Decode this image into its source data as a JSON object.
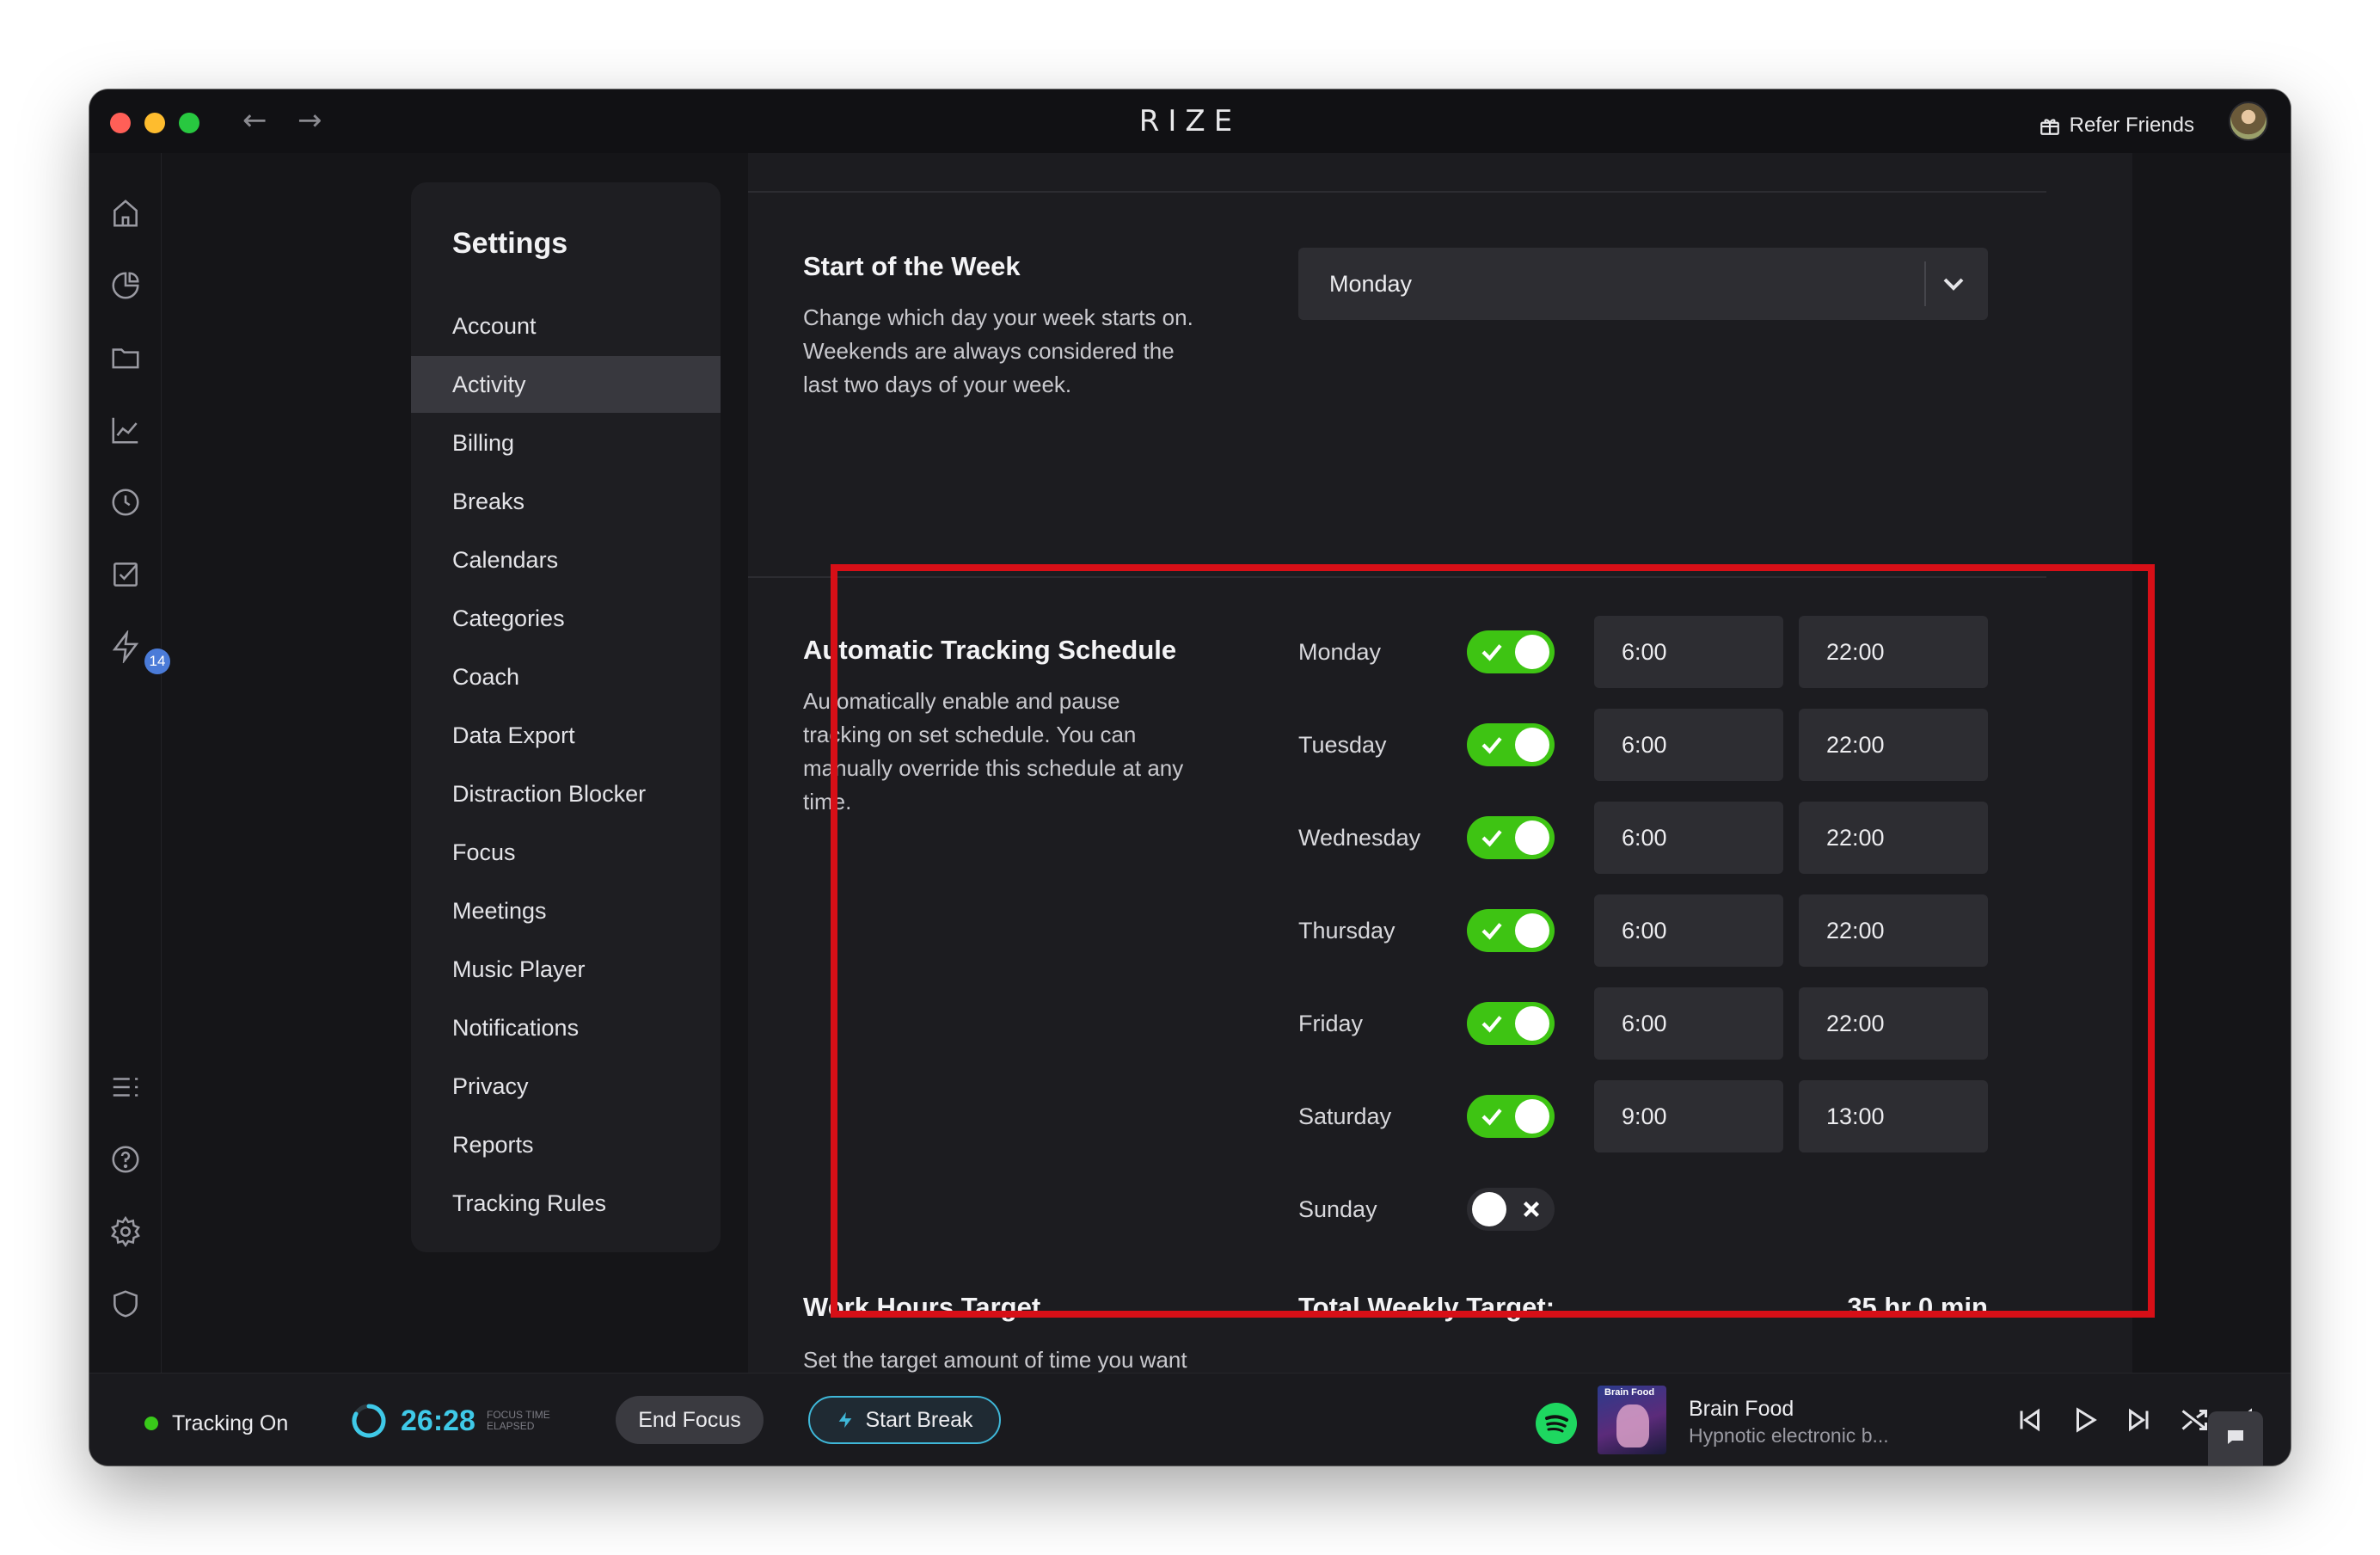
{
  "window": {
    "app_title": "RIZE",
    "refer_label": "Refer Friends"
  },
  "rail": {
    "notification_count": "14"
  },
  "settings_nav": {
    "title": "Settings",
    "items": [
      {
        "label": "Account"
      },
      {
        "label": "Activity",
        "active": true
      },
      {
        "label": "Billing"
      },
      {
        "label": "Breaks"
      },
      {
        "label": "Calendars"
      },
      {
        "label": "Categories"
      },
      {
        "label": "Coach"
      },
      {
        "label": "Data Export"
      },
      {
        "label": "Distraction Blocker"
      },
      {
        "label": "Focus"
      },
      {
        "label": "Meetings"
      },
      {
        "label": "Music Player"
      },
      {
        "label": "Notifications"
      },
      {
        "label": "Privacy"
      },
      {
        "label": "Reports"
      },
      {
        "label": "Tracking Rules"
      }
    ]
  },
  "week_start": {
    "title": "Start of the Week",
    "description_lines": [
      "Change which day your week starts on.",
      "Weekends are always considered the",
      "last two days of your week."
    ],
    "selected": "Monday"
  },
  "schedule": {
    "title": "Automatic Tracking Schedule",
    "description_lines": [
      "Automatically enable and pause",
      "tracking on set schedule. You can",
      "manually override this schedule at any",
      "time."
    ],
    "days": [
      {
        "day": "Monday",
        "enabled": true,
        "start": "6:00",
        "end": "22:00"
      },
      {
        "day": "Tuesday",
        "enabled": true,
        "start": "6:00",
        "end": "22:00"
      },
      {
        "day": "Wednesday",
        "enabled": true,
        "start": "6:00",
        "end": "22:00"
      },
      {
        "day": "Thursday",
        "enabled": true,
        "start": "6:00",
        "end": "22:00"
      },
      {
        "day": "Friday",
        "enabled": true,
        "start": "6:00",
        "end": "22:00"
      },
      {
        "day": "Saturday",
        "enabled": true,
        "start": "9:00",
        "end": "13:00"
      },
      {
        "day": "Sunday",
        "enabled": false,
        "start": "",
        "end": ""
      }
    ]
  },
  "work_hours": {
    "title": "Work Hours Target",
    "description": "Set the target amount of time you want",
    "weekly_label": "Total Weekly Target:",
    "weekly_value": "35 hr 0 min"
  },
  "bottom_bar": {
    "status": "Tracking On",
    "timer": "26:28",
    "timer_caption_1": "FOCUS TIME",
    "timer_caption_2": "ELAPSED",
    "end_focus": "End Focus",
    "start_break": "Start Break",
    "track_title": "Brain Food",
    "track_subtitle": "Hypnotic electronic b...",
    "album_label": "Brain Food"
  },
  "colors": {
    "accent_green": "#3ec413",
    "accent_cyan": "#3fc9e8",
    "highlight_red": "#d70f17"
  }
}
